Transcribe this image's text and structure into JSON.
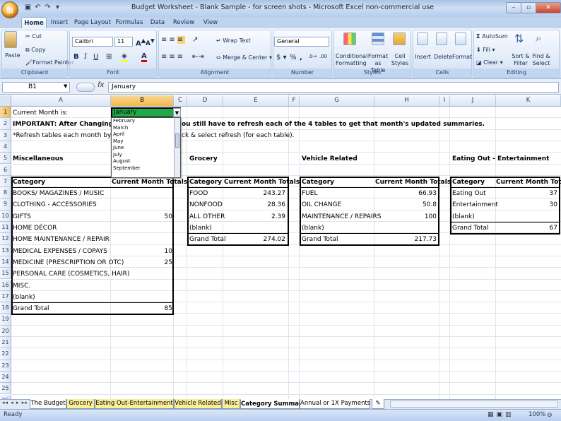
{
  "window": {
    "title": "Budget Worksheet - Blank Sample - for screen shots - Microsoft Excel non-commercial use"
  },
  "ribbon_tabs": [
    "Home",
    "Insert",
    "Page Layout",
    "Formulas",
    "Data",
    "Review",
    "View"
  ],
  "ribbon": {
    "clipboard": {
      "label": "Clipboard",
      "paste": "Paste",
      "cut": "Cut",
      "copy": "Copy",
      "format_painter": "Format Painter"
    },
    "font": {
      "label": "Font",
      "name": "Calibri",
      "size": "11"
    },
    "alignment": {
      "label": "Alignment",
      "wrap": "Wrap Text",
      "merge": "Merge & Center"
    },
    "number": {
      "label": "Number",
      "format": "General"
    },
    "styles": {
      "label": "Styles",
      "conditional": "Conditional Formatting",
      "format_table": "Format as Table",
      "cell_styles": "Cell Styles"
    },
    "cells": {
      "label": "Cells",
      "insert": "Insert",
      "delete": "Delete",
      "format": "Format"
    },
    "editing": {
      "label": "Editing",
      "autosum": "AutoSum",
      "fill": "Fill",
      "clear": "Clear",
      "sort": "Sort & Filter",
      "find": "Find & Select"
    }
  },
  "formula_bar": {
    "name_box": "B1",
    "fx": "fx",
    "value": "January"
  },
  "columns": [
    "A",
    "B",
    "C",
    "D",
    "E",
    "F",
    "G",
    "H",
    "I",
    "J",
    "K"
  ],
  "rows": [
    "1",
    "2",
    "3",
    "4",
    "5",
    "6",
    "7",
    "8",
    "9",
    "10",
    "11",
    "12",
    "13",
    "14",
    "15",
    "16",
    "17",
    "18",
    "19",
    "20",
    "21",
    "22",
    "23",
    "24",
    "25",
    "26"
  ],
  "sheet": {
    "a1": "Current Month is:",
    "b1": "January",
    "a2_left": "IMPORTANT: After Changing the Mo",
    "a2_right": "ou still have to refresh each of the 4 tables to get that month's updated summaries.",
    "a3_left": "*Refresh tables each month by putt",
    "a3_right": "ck & select refresh (for each table).",
    "misc_title": "Miscellaneous",
    "grocery_title": "Grocery",
    "vehicle_title": "Vehicle Related",
    "eating_title": "Eating Out - Entertainment",
    "hdr_category": "Category",
    "hdr_totals": "Current Month Totals",
    "misc_rows": [
      {
        "c": "BOOKS/ MAGAZINES / MUSIC",
        "v": ""
      },
      {
        "c": "CLOTHING - ACCESSORIES",
        "v": ""
      },
      {
        "c": "GIFTS",
        "v": "50"
      },
      {
        "c": "HOME DÉCOR",
        "v": ""
      },
      {
        "c": "HOME MAINTENANCE / REPAIR",
        "v": ""
      },
      {
        "c": "MEDICAL EXPENSES / COPAYS",
        "v": "10"
      },
      {
        "c": "MEDICINE (PRESCRIPTION OR OTC)",
        "v": "25"
      },
      {
        "c": "PERSONAL CARE (COSMETICS, HAIR)",
        "v": ""
      },
      {
        "c": "MISC.",
        "v": ""
      },
      {
        "c": "(blank)",
        "v": ""
      },
      {
        "c": "Grand Total",
        "v": "85"
      }
    ],
    "grocery_rows": [
      {
        "c": "FOOD",
        "v": "243.27"
      },
      {
        "c": "NONFOOD",
        "v": "28.36"
      },
      {
        "c": "ALL OTHER",
        "v": "2.39"
      },
      {
        "c": "(blank)",
        "v": ""
      },
      {
        "c": "Grand Total",
        "v": "274.02"
      }
    ],
    "vehicle_rows": [
      {
        "c": "FUEL",
        "v": "66.93"
      },
      {
        "c": "OIL CHANGE",
        "v": "50.8"
      },
      {
        "c": "MAINTENANCE / REPAIRS",
        "v": "100"
      },
      {
        "c": "(blank)",
        "v": ""
      },
      {
        "c": "Grand Total",
        "v": "217.73"
      }
    ],
    "eating_rows": [
      {
        "c": "Eating Out",
        "v": "37"
      },
      {
        "c": "Entertainment",
        "v": "30"
      },
      {
        "c": "(blank)",
        "v": ""
      },
      {
        "c": "Grand Total",
        "v": "67"
      }
    ]
  },
  "dropdown_items": [
    "February",
    "March",
    "April",
    "May",
    "June",
    "July",
    "August",
    "September"
  ],
  "sheet_tabs": [
    "The Budget",
    "Grocery",
    "Eating Out-Entertainment",
    "Vehicle Related",
    "Misc",
    "Category Summary",
    "Annual or 1X Payments"
  ],
  "status": {
    "ready": "Ready",
    "zoom": "100%"
  }
}
